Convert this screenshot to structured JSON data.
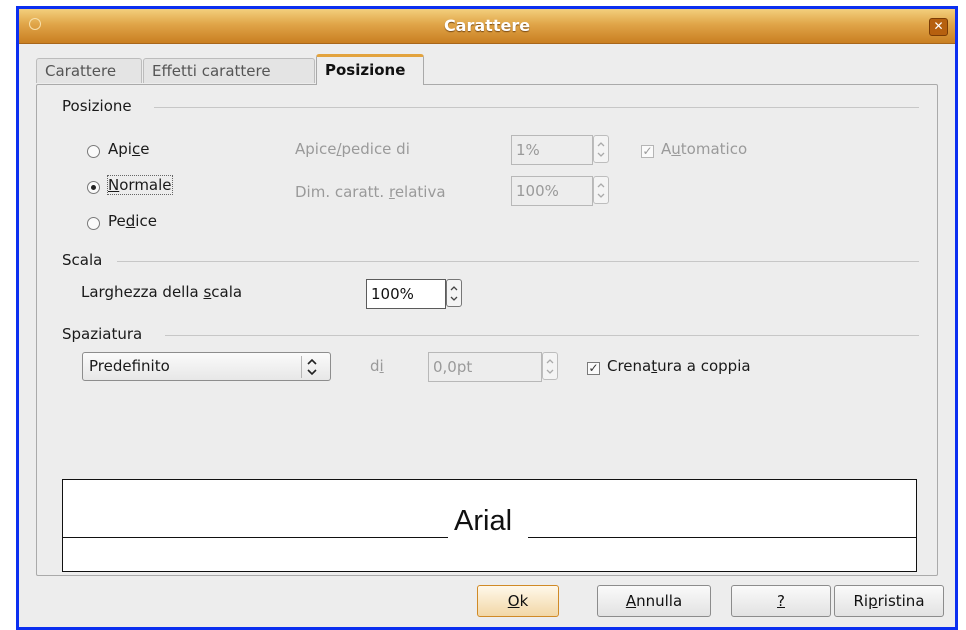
{
  "window": {
    "title": "Carattere",
    "close_glyph": "✕"
  },
  "tabs": [
    {
      "label": "Carattere",
      "active": false
    },
    {
      "label": "Effetti carattere",
      "active": false
    },
    {
      "label": "Posizione",
      "active": true
    }
  ],
  "posizione_section": {
    "label": "Posizione",
    "radios": [
      {
        "pre": "Api",
        "acc": "c",
        "post": "e",
        "checked": false
      },
      {
        "pre": "",
        "acc": "N",
        "post": "ormale",
        "checked": true
      },
      {
        "pre": "Pe",
        "acc": "d",
        "post": "ice",
        "checked": false
      }
    ],
    "raise_lower": {
      "pre": "Apice",
      "acc": "/",
      "post": "pedice di",
      "value": "1%"
    },
    "relative_size": {
      "pre": "Dim. caratt. ",
      "acc": "r",
      "post": "elativa",
      "value": "100%"
    },
    "automatic": {
      "pre": "A",
      "acc": "u",
      "post": "tomatico",
      "checked": true
    }
  },
  "scala_section": {
    "label": "Scala",
    "width": {
      "pre": "Larghezza della ",
      "acc": "s",
      "post": "cala",
      "value": "100%"
    }
  },
  "spaziatura_section": {
    "label": "Spaziatura",
    "mode": "Predefinito",
    "by": {
      "pre": "d",
      "acc": "i",
      "post": ""
    },
    "by_value": "0,0pt",
    "pair_kerning": {
      "pre": "Crena",
      "acc": "t",
      "post": "ura a coppia",
      "checked": true
    }
  },
  "preview": {
    "text": "Arial"
  },
  "buttons": {
    "ok": {
      "pre": "",
      "acc": "O",
      "post": "k"
    },
    "cancel": {
      "pre": "",
      "acc": "A",
      "post": "nnulla"
    },
    "help": {
      "pre": "",
      "acc": "?",
      "post": ""
    },
    "reset": {
      "pre": "Ri",
      "acc": "p",
      "post": "ristina"
    }
  },
  "colors": {
    "titlebar": "#e0a548",
    "frame": "#0b2ff0",
    "dialog_bg": "#ededed",
    "active_tab_accent": "#e3a33d"
  },
  "icons": {
    "checkbox_checked": "✓",
    "combo_arrow": "updown-chevron-icon",
    "spin_arrows": "spin-arrow-icon"
  }
}
